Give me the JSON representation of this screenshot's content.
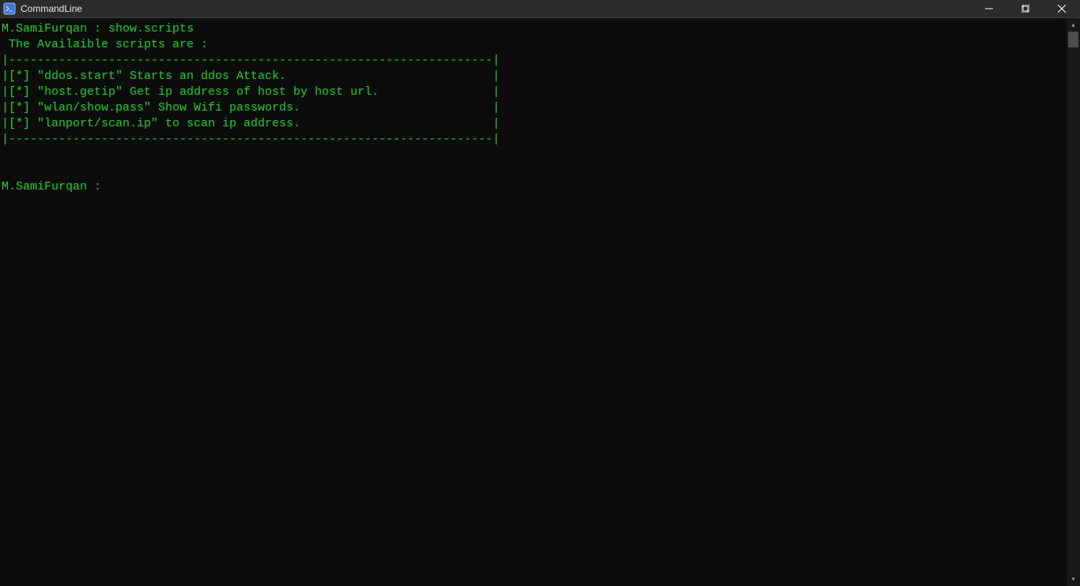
{
  "window": {
    "title": "CommandLine"
  },
  "terminal": {
    "prompt_user": "M.SamiFurqan",
    "prompt_sep": " : ",
    "command": "show.scripts",
    "header_line": " The Availaible scripts are :",
    "divider": "|--------------------------------------------------------------------|",
    "rows": [
      {
        "text": "|[*] \"ddos.start\" Starts an ddos Attack.                             |"
      },
      {
        "text": "|[*] \"host.getip\" Get ip address of host by host url.                |"
      },
      {
        "text": "|[*] \"wlan/show.pass\" Show Wifi passwords.                           |"
      },
      {
        "text": "|[*] \"lanport/scan.ip\" to scan ip address.                           |"
      }
    ],
    "blank": "",
    "prompt2": "M.SamiFurqan : "
  }
}
